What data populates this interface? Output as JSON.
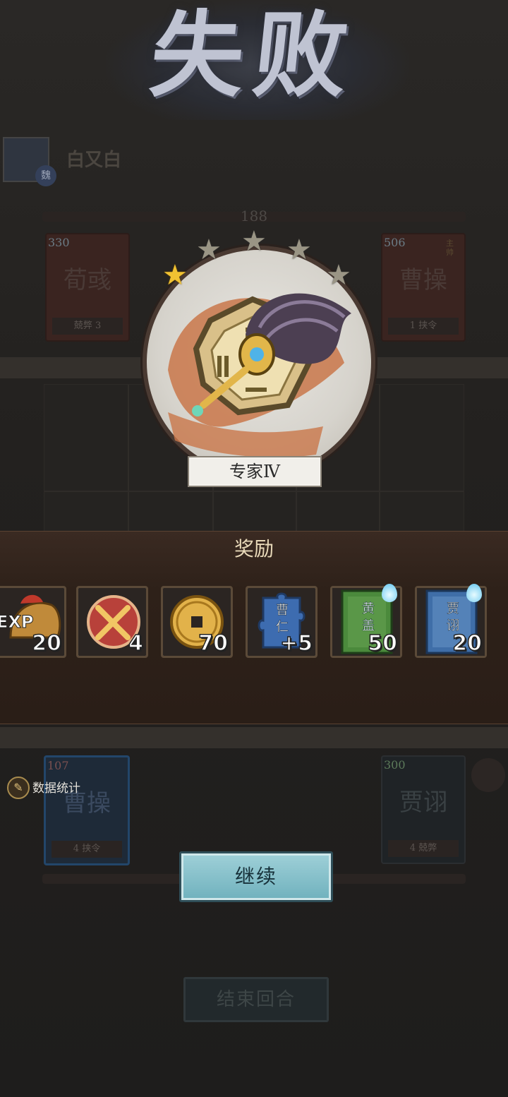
{
  "screen": {
    "title": "失败",
    "opponent": {
      "name": "白又白",
      "badge": "魏",
      "hp": "188"
    },
    "opponent_cards": [
      {
        "cost": "330",
        "name": "荀彧",
        "tag": "",
        "stat_left": "兢弊",
        "stat_right": "3"
      },
      {
        "cost": "506",
        "name": "曹操",
        "tag": "主帅",
        "stat_left": "1",
        "stat_right": "挟令"
      }
    ],
    "player_cards": [
      {
        "cost": "107",
        "name": "曹操",
        "stat_left": "4",
        "stat_right": "挟令"
      },
      {
        "cost": "300",
        "name": "贾诩",
        "stat_left": "4",
        "stat_right": "兢弊"
      }
    ]
  },
  "result": {
    "stars_total": 5,
    "stars_lit": 1,
    "rank": "专家Ⅳ"
  },
  "rewards": {
    "title": "奖励",
    "items": [
      {
        "label": "EXP",
        "count": "20",
        "icon": "exp-helmet-icon"
      },
      {
        "label": "",
        "count": "4",
        "icon": "crossed-swords-icon"
      },
      {
        "label": "",
        "count": "70",
        "icon": "coin-icon"
      },
      {
        "label": "曹仁",
        "count": "+5",
        "icon": "puzzle-piece-icon"
      },
      {
        "label": "黄盖",
        "count": "50",
        "icon": "card-icon"
      },
      {
        "label": "贾诩",
        "count": "20",
        "icon": "card-icon"
      }
    ]
  },
  "actions": {
    "stats_label": "数据统计",
    "continue_label": "继续",
    "end_turn_label": "结束回合"
  },
  "colors": {
    "accent_teal": "#6fb1bd",
    "star_gold": "#f1c232",
    "panel_brown": "#2e2119"
  }
}
